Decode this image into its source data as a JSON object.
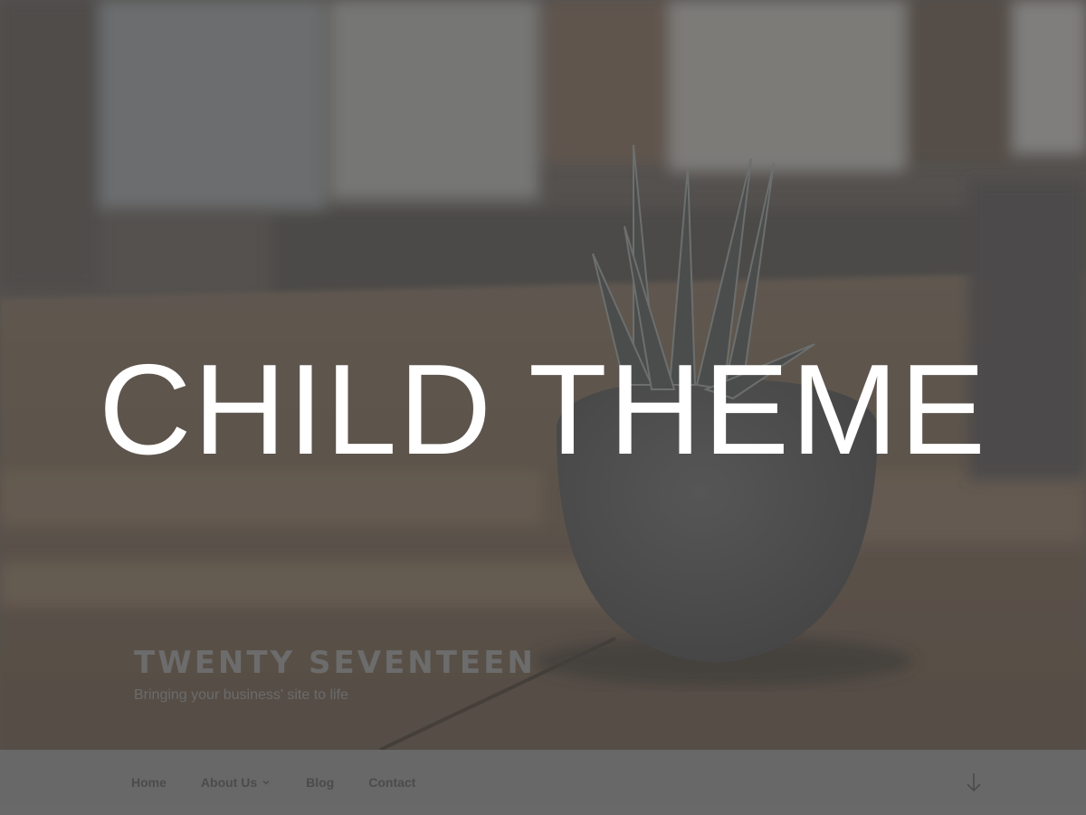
{
  "overlay": {
    "heading": "CHILD THEME"
  },
  "site": {
    "title": "TWENTY SEVENTEEN",
    "tagline": "Bringing your business' site to life"
  },
  "nav": {
    "items": [
      {
        "label": "Home"
      },
      {
        "label": "About Us",
        "has_submenu": true
      },
      {
        "label": "Blog"
      },
      {
        "label": "Contact"
      }
    ],
    "scroll_icon": "arrow-down-icon"
  },
  "colors": {
    "nav_background": "#666666",
    "overlay_text": "#ffffff"
  }
}
